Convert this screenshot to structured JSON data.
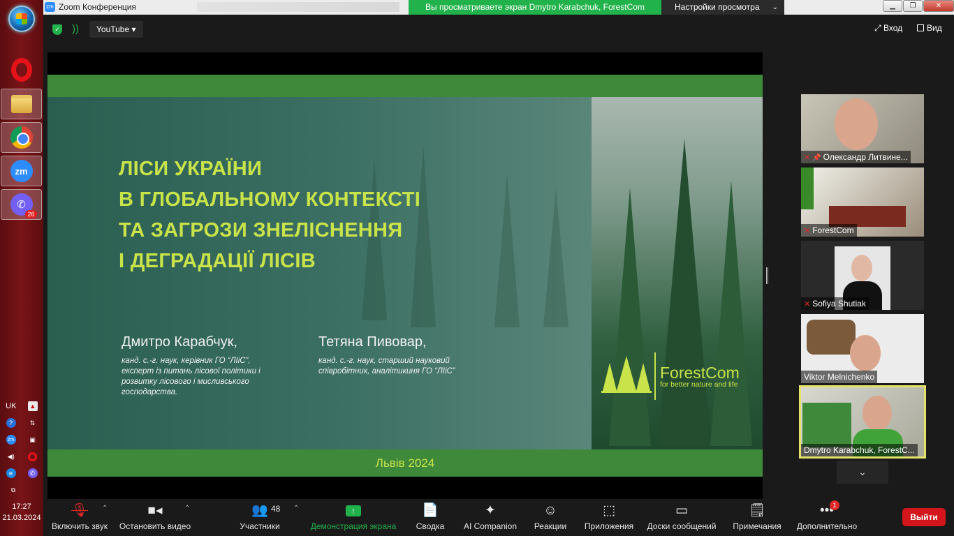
{
  "taskbar": {
    "viber_badge": "26",
    "lang": "UK",
    "clock_time": "17:27",
    "clock_date": "21.03.2024"
  },
  "window": {
    "title": "Zoom Конференция",
    "share_banner": "Вы просматриваете экран Dmytro Karabchuk, ForestCom",
    "view_settings": "Настройки просмотра"
  },
  "topbar": {
    "stream_label": "YouTube",
    "enter_label": "Вход",
    "view_label": "Вид"
  },
  "slide": {
    "title_lines": [
      "ЛІСИ УКРАЇНИ",
      "В ГЛОБАЛЬНОМУ КОНТЕКСТІ",
      "ТА ЗАГРОЗИ ЗНЕЛІСНЕННЯ",
      "І ДЕГРАДАЦІЇ ЛІСІВ"
    ],
    "author1_name": "Дмитро Карабчук,",
    "author1_desc": [
      "канд. с.-г. наук, керівник ГО “ЛІіС”,",
      "експерт із питань лісової політики і",
      "розвитку лісового і мисливського",
      "господарства."
    ],
    "author2_name": "Тетяна Пивовар,",
    "author2_desc": [
      "канд. с.-г. наук, старший науковий",
      "співробітник, аналітикиня ГО “ЛІіС”"
    ],
    "logo_name": "ForestCom",
    "logo_tagline": "for better nature and life",
    "city_year": "Львів 2024",
    "colors": {
      "accent": "#c9e34a",
      "band": "#3f8a3a"
    }
  },
  "participants": [
    {
      "name": "Олександр Литвине...",
      "muted": true,
      "pinned": true
    },
    {
      "name": "ForestCom",
      "muted": true
    },
    {
      "name": "Sofiya Shutiak",
      "muted": true
    },
    {
      "name": "Viktor Melnichenko",
      "muted": false
    },
    {
      "name": "Dmytro Karabchuk, ForestC...",
      "muted": false,
      "active_speaker": true
    }
  ],
  "toolbar": {
    "mute": "Включить звук",
    "video": "Остановить видео",
    "participants": "Участники",
    "participants_count": "48",
    "share": "Демонстрация экрана",
    "summary": "Сводка",
    "ai": "AI Companion",
    "reactions": "Реакции",
    "apps": "Приложения",
    "whiteboards": "Доски сообщений",
    "notes": "Примечания",
    "more": "Дополнительно",
    "more_badge": "1",
    "leave": "Выйти"
  }
}
